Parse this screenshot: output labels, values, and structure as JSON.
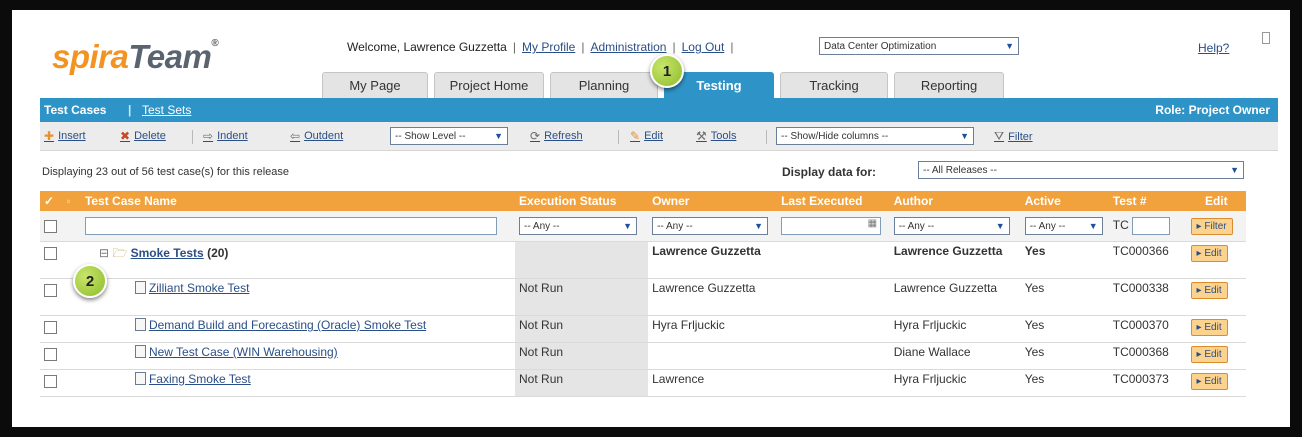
{
  "logo": {
    "spira": "spira",
    "team": "Team",
    "reg": "®"
  },
  "header": {
    "welcome": "Welcome, Lawrence Guzzetta",
    "links": [
      "My Profile",
      "Administration",
      "Log Out"
    ],
    "project_select": "Data Center Optimization",
    "help": "Help?"
  },
  "tabs": [
    "My Page",
    "Project Home",
    "Planning",
    "Testing",
    "Tracking",
    "Reporting"
  ],
  "bluebar": {
    "left": [
      "Test Cases",
      "Test Sets"
    ],
    "role": "Role: Project Owner"
  },
  "toolbar": {
    "insert": "Insert",
    "delete": "Delete",
    "indent": "Indent",
    "outdent": "Outdent",
    "show_level": "-- Show Level --",
    "refresh": "Refresh",
    "edit": "Edit",
    "tools": "Tools",
    "show_hide": "-- Show/Hide columns --",
    "filter": "Filter"
  },
  "status_line": "Displaying 23 out of 56 test case(s) for this release",
  "display_data_for": {
    "label": "Display data for:",
    "value": "-- All Releases --"
  },
  "grid": {
    "headers": [
      "Test Case Name",
      "Execution Status",
      "Owner",
      "Last Executed",
      "Author",
      "Active",
      "Test #",
      "Edit"
    ],
    "filter": {
      "any": "-- Any --",
      "tc_prefix": "TC",
      "filter_btn": "Filter"
    },
    "folder": {
      "name": "Smoke Tests",
      "count": "(20)",
      "owner": "Lawrence Guzzetta",
      "author": "Lawrence Guzzetta",
      "active": "Yes",
      "test_no": "TC000366",
      "edit": "Edit"
    },
    "rows": [
      {
        "name": "Zilliant Smoke Test",
        "status": "Not Run",
        "owner": "Lawrence Guzzetta",
        "author": "Lawrence Guzzetta",
        "active": "Yes",
        "test_no": "TC000338",
        "edit": "Edit"
      },
      {
        "name": "Demand Build and Forecasting (Oracle) Smoke Test",
        "status": "Not Run",
        "owner": "Hyra Frljuckic",
        "author": "Hyra Frljuckic",
        "active": "Yes",
        "test_no": "TC000370",
        "edit": "Edit"
      },
      {
        "name": "New Test Case (WIN Warehousing)",
        "status": "Not Run",
        "owner": "",
        "author": "Diane Wallace",
        "active": "Yes",
        "test_no": "TC000368",
        "edit": "Edit"
      },
      {
        "name": "Faxing Smoke Test",
        "status": "Not Run",
        "owner": "Lawrence",
        "author": "Hyra Frljuckic",
        "active": "Yes",
        "test_no": "TC000373",
        "edit": "Edit"
      }
    ]
  },
  "badges": [
    "1",
    "2"
  ],
  "colors": {
    "accent_blue": "#2e94c7",
    "header_orange": "#f2a23d",
    "logo_orange": "#f39322"
  }
}
